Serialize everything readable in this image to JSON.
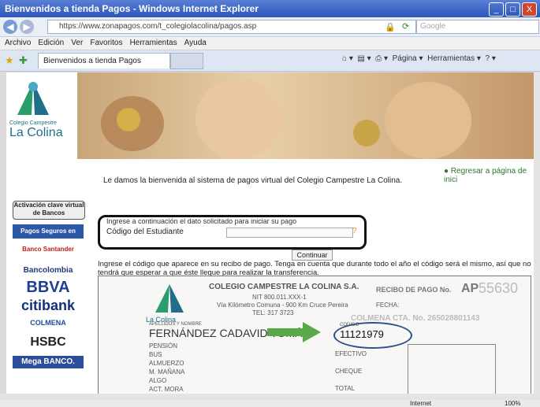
{
  "window": {
    "title": "Bienvenidos a tienda Pagos - Windows Internet Explorer",
    "controls": [
      "_",
      "□",
      "X"
    ]
  },
  "address": {
    "url": "https://www.zonapagos.com/t_colegiolacolina/pagos.asp",
    "search_placeholder": "Google"
  },
  "menu": [
    "Archivo",
    "Edición",
    "Ver",
    "Favoritos",
    "Herramientas",
    "Ayuda"
  ],
  "tab": {
    "title": "Bienvenidos a tienda Pagos"
  },
  "command_bar": {
    "page_label": "Página",
    "tools_label": "Herramientas"
  },
  "logo": {
    "small": "Colegio Campestre",
    "name": "La Colina"
  },
  "regresar": "Regresar a página de inici",
  "sidebar": {
    "activacion": "Activación clave virtual de Bancos",
    "pse": "Pagos Seguros en Línea PSE",
    "banks": [
      "Banco Santander",
      "Bancolombia",
      "BBVA",
      "citibank",
      "COLMENA",
      "HSBC",
      "Mega BANCO."
    ]
  },
  "welcome": "Le damos la bienvenida al sistema de pagos virtual del Colegio Campestre La Colina.",
  "form": {
    "instruction": "Ingrese a continuación el dato solicitado para iniciar su pago",
    "field_label": "Código del Estudiante",
    "code_value": "",
    "continue_label": "Continuar"
  },
  "info": "Ingrese el código que aparece en su recibo de pago. Tenga en cuenta que durante todo el año el código será el mismo, así que no tendrá que esperar a que éste llegue para realizar la transferencia.",
  "receipt": {
    "school": "COLEGIO CAMPESTRE LA COLINA S.A.",
    "nit": "NIT 800.011.XXX-1",
    "address": "Vía Kilómetro Comuna - 900 Km Cruce Pereira",
    "tel": "TEL: 317 3723",
    "receipt_label": "RECIBO DE PAGO No.",
    "receipt_prefix": "AP",
    "receipt_number": "55630",
    "fecha_label": "FECHA:",
    "bank_line": "COLMENA CTA. No. 265028801143",
    "name_field_label": "APELLIDOS Y NOMBRE",
    "student_name": "FERNÁNDEZ CADAVID TOMÁS",
    "codigo_label": "CODIGO",
    "student_code": "11121979",
    "items": [
      "PENSIÓN",
      "BUS",
      "ALMUERZO",
      "M. MAÑANA",
      "ALGO",
      "ACT. MORA"
    ],
    "payment_labels": [
      "EFECTIVO",
      "CHEQUE",
      "TOTAL"
    ],
    "logo_name": "La Colina"
  },
  "status": {
    "zone": "Internet",
    "zoom": "100%"
  }
}
